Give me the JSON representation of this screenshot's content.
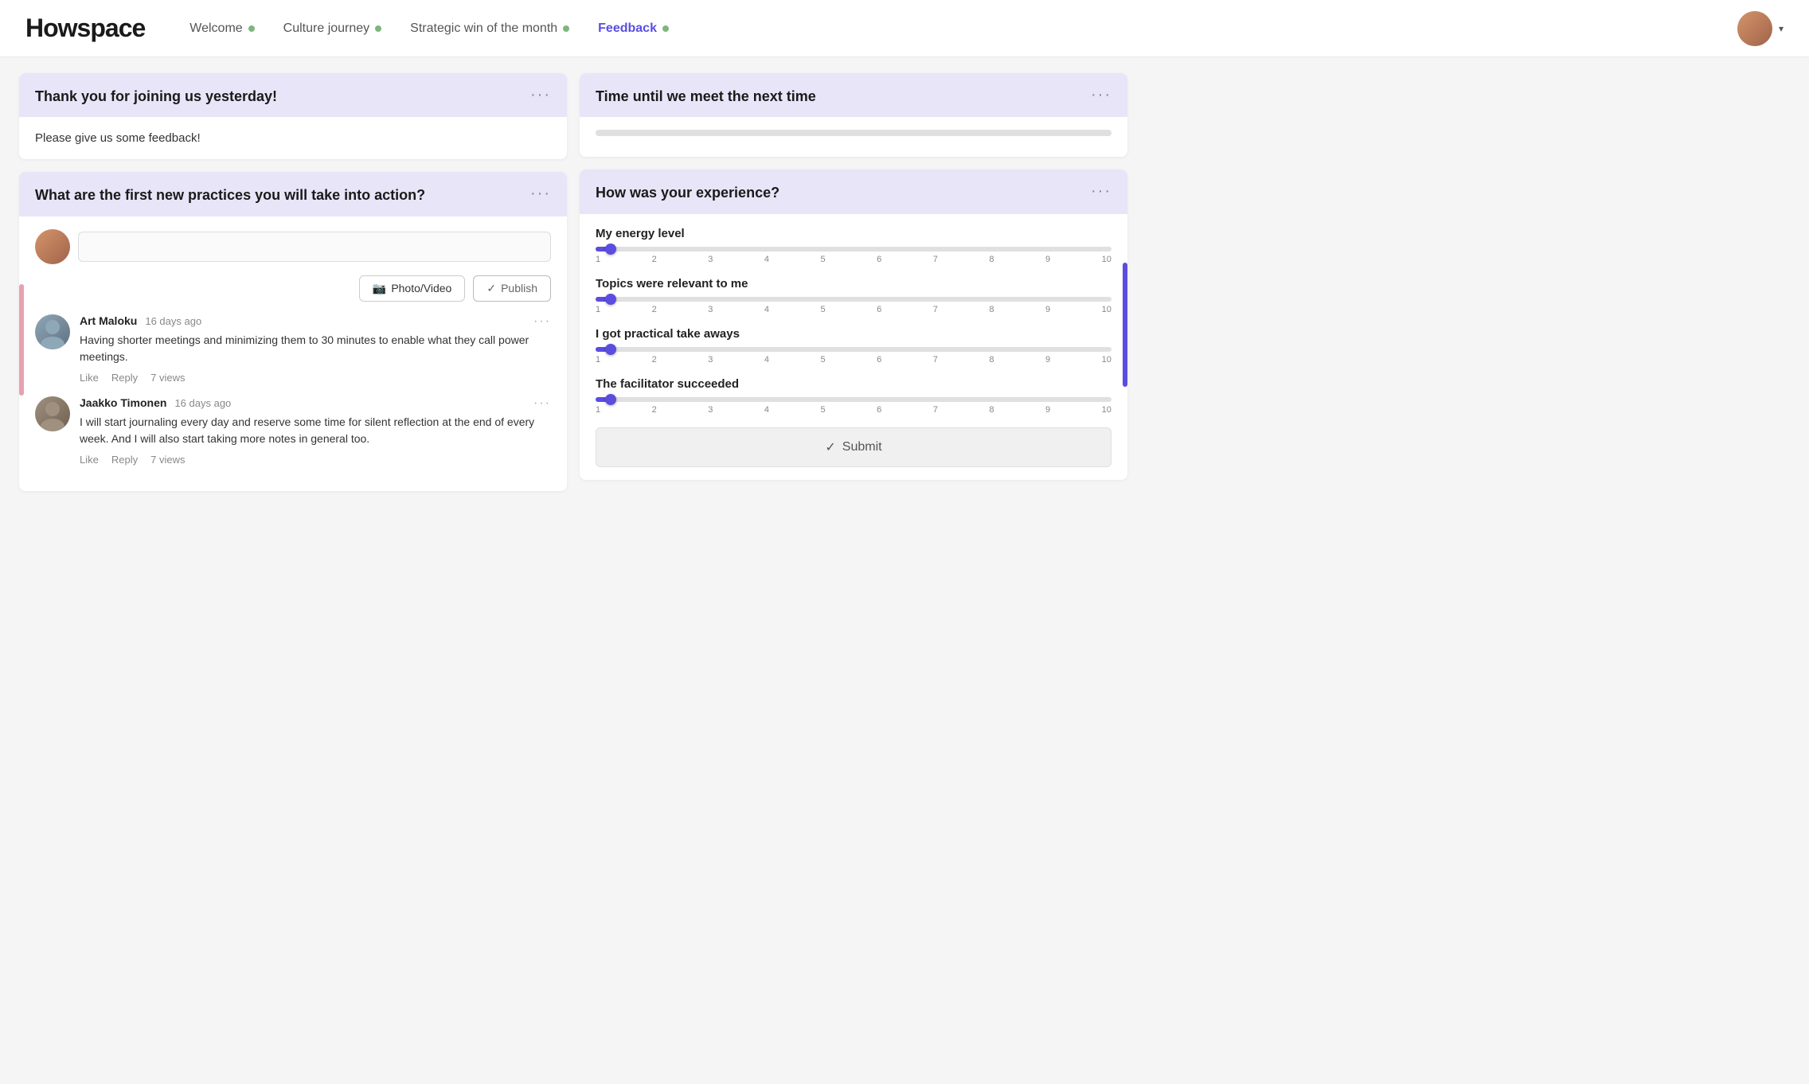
{
  "logo": "Howspace",
  "nav": {
    "links": [
      {
        "label": "Welcome",
        "active": false,
        "dot": true
      },
      {
        "label": "Culture journey",
        "active": false,
        "dot": true
      },
      {
        "label": "Strategic win of the month",
        "active": false,
        "dot": true
      },
      {
        "label": "Feedback",
        "active": true,
        "dot": true
      }
    ]
  },
  "cards": {
    "thankyou": {
      "title": "Thank you for joining us yesterday!",
      "body": "Please give us some feedback!"
    },
    "practices": {
      "title": "What are the first new practices you will take into action?",
      "input_placeholder": "",
      "photo_btn": "Photo/Video",
      "publish_btn": "Publish",
      "comments": [
        {
          "author": "Art Maloku",
          "time": "16 days ago",
          "text": "Having shorter meetings and minimizing them to 30 minutes to enable what they call power meetings.",
          "like": "Like",
          "reply": "Reply",
          "views": "7 views"
        },
        {
          "author": "Jaakko Timonen",
          "time": "16 days ago",
          "text": "I will start journaling every day and reserve some time for silent reflection at the end of every week. And I will also start taking more notes in general too.",
          "like": "Like",
          "reply": "Reply",
          "views": "7 views"
        }
      ]
    },
    "time": {
      "title": "Time until we meet the next time"
    },
    "experience": {
      "title": "How was your experience?",
      "sliders": [
        {
          "label": "My energy level",
          "value": 1
        },
        {
          "label": "Topics were relevant to me",
          "value": 1
        },
        {
          "label": "I got practical take aways",
          "value": 1
        },
        {
          "label": "The facilitator succeeded",
          "value": 1
        }
      ],
      "scale": [
        "1",
        "2",
        "3",
        "4",
        "5",
        "6",
        "7",
        "8",
        "9",
        "10"
      ],
      "submit_btn": "Submit"
    }
  },
  "icons": {
    "more": "···",
    "check": "✓",
    "camera": "📷"
  }
}
